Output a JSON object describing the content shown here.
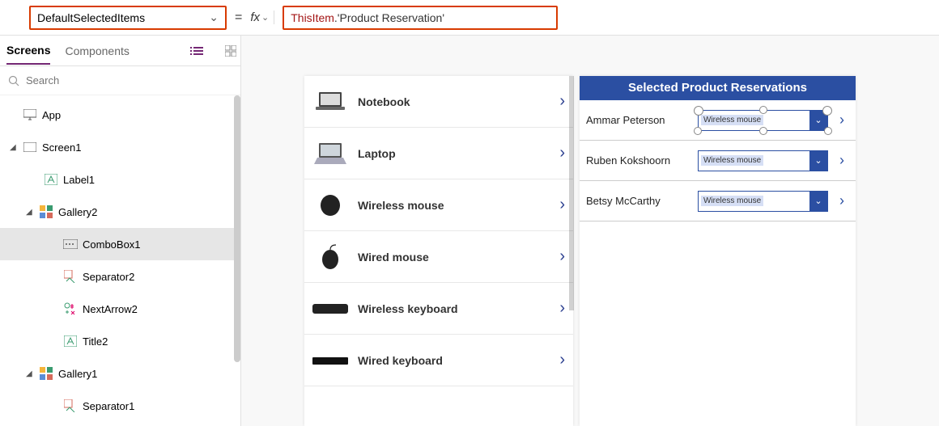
{
  "formula": {
    "property": "DefaultSelectedItems",
    "equals": "=",
    "fx": "fx",
    "expr_obj": "ThisItem",
    "expr_rest": ".'Product Reservation'"
  },
  "panel": {
    "tabs": {
      "screens": "Screens",
      "components": "Components"
    },
    "search_placeholder": "Search",
    "tree": {
      "app": "App",
      "screen1": "Screen1",
      "label1": "Label1",
      "gallery2": "Gallery2",
      "combobox1": "ComboBox1",
      "separator2": "Separator2",
      "nextarrow2": "NextArrow2",
      "title2": "Title2",
      "gallery1": "Gallery1",
      "separator1": "Separator1"
    }
  },
  "gallery1": {
    "items": [
      {
        "label": "Notebook"
      },
      {
        "label": "Laptop"
      },
      {
        "label": "Wireless mouse"
      },
      {
        "label": "Wired mouse"
      },
      {
        "label": "Wireless keyboard"
      },
      {
        "label": "Wired keyboard"
      }
    ]
  },
  "gallery2": {
    "header": "Selected Product Reservations",
    "items": [
      {
        "name": "Ammar Peterson",
        "chip": "Wireless mouse"
      },
      {
        "name": "Ruben Kokshoorn",
        "chip": "Wireless mouse"
      },
      {
        "name": "Betsy McCarthy",
        "chip": "Wireless mouse"
      }
    ]
  }
}
